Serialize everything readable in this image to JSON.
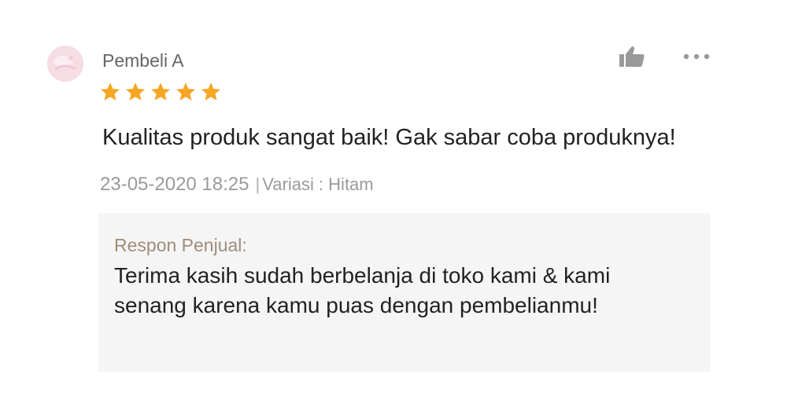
{
  "review": {
    "reviewer_name": "Pembeli A",
    "rating": 5,
    "rating_max": 5,
    "text": "Kualitas produk sangat baik! Gak sabar coba produknya!",
    "date": "23-05-2020 18:25",
    "separator": "|",
    "variant": "Variasi : Hitam",
    "icons": {
      "avatar": "avatar-image",
      "star": "star-icon",
      "like": "thumbs-up-icon",
      "more": "more-options-icon"
    }
  },
  "seller_response": {
    "label": "Respon Penjual:",
    "text": "Terima kasih sudah berbelanja di toko kami & kami senang karena kamu puas dengan pembelianmu!"
  },
  "colors": {
    "star": "#f5a623",
    "name": "#666666",
    "meta": "#9a9a9a",
    "seller_label": "#a08c7a",
    "seller_bg": "#f5f5f5",
    "icon": "#999999"
  }
}
